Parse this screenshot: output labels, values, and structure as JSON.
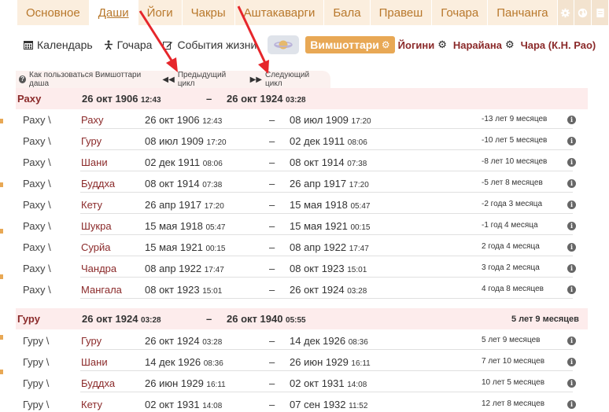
{
  "tabs": [
    {
      "label": "Основное"
    },
    {
      "label": "Даши",
      "active": true
    },
    {
      "label": "Йоги"
    },
    {
      "label": "Чакры"
    },
    {
      "label": "Аштакаварги"
    },
    {
      "label": "Бала"
    },
    {
      "label": "Правеш"
    },
    {
      "label": "Гочара"
    },
    {
      "label": "Панчанга"
    }
  ],
  "subnav": {
    "calendar": "Календарь",
    "gochara": "Гочара",
    "life_events": "События жизни",
    "vimshottari": "Вимшоттари",
    "yogini": "Йогини",
    "narayana": "Нарайана",
    "chara": "Чара (К.Н. Рао)"
  },
  "cycles": {
    "how_to": "Как пользоваться Вимшоттари даша",
    "prev": "Предыдущий цикл",
    "next": "Следующий цикл"
  },
  "dasha": [
    {
      "planet": "Раху",
      "start_date": "26 окт 1906",
      "start_time": "12:43",
      "end_date": "26 окт 1924",
      "end_time": "03:28",
      "duration": "",
      "rows": [
        {
          "lead": "Раху \\",
          "planet": "Раху",
          "sd": "26 окт 1906",
          "st": "12:43",
          "ed": "08 июл 1909",
          "et": "17:20",
          "dur": "-13 лет 9 месяцев"
        },
        {
          "lead": "Раху \\",
          "planet": "Гуру",
          "sd": "08 июл 1909",
          "st": "17:20",
          "ed": "02 дек 1911",
          "et": "08:06",
          "dur": "-10 лет 5 месяцев"
        },
        {
          "lead": "Раху \\",
          "planet": "Шани",
          "sd": "02 дек 1911",
          "st": "08:06",
          "ed": "08 окт 1914",
          "et": "07:38",
          "dur": "-8 лет 10 месяцев"
        },
        {
          "lead": "Раху \\",
          "planet": "Буддха",
          "sd": "08 окт 1914",
          "st": "07:38",
          "ed": "26 апр 1917",
          "et": "17:20",
          "dur": "-5 лет 8 месяцев"
        },
        {
          "lead": "Раху \\",
          "planet": "Кету",
          "sd": "26 апр 1917",
          "st": "17:20",
          "ed": "15 мая 1918",
          "et": "05:47",
          "dur": "-2 года 3 месяца"
        },
        {
          "lead": "Раху \\",
          "planet": "Шукра",
          "sd": "15 мая 1918",
          "st": "05:47",
          "ed": "15 мая 1921",
          "et": "00:15",
          "dur": "-1 год 4 месяца"
        },
        {
          "lead": "Раху \\",
          "planet": "Сурйа",
          "sd": "15 мая 1921",
          "st": "00:15",
          "ed": "08 апр 1922",
          "et": "17:47",
          "dur": "2 года 4 месяца"
        },
        {
          "lead": "Раху \\",
          "planet": "Чандра",
          "sd": "08 апр 1922",
          "st": "17:47",
          "ed": "08 окт 1923",
          "et": "15:01",
          "dur": "3 года 2 месяца"
        },
        {
          "lead": "Раху \\",
          "planet": "Мангала",
          "sd": "08 окт 1923",
          "st": "15:01",
          "ed": "26 окт 1924",
          "et": "03:28",
          "dur": "4 года 8 месяцев"
        }
      ]
    },
    {
      "planet": "Гуру",
      "start_date": "26 окт 1924",
      "start_time": "03:28",
      "end_date": "26 окт 1940",
      "end_time": "05:55",
      "duration": "5 лет 9 месяцев",
      "rows": [
        {
          "lead": "Гуру \\",
          "planet": "Гуру",
          "sd": "26 окт 1924",
          "st": "03:28",
          "ed": "14 дек 1926",
          "et": "08:36",
          "dur": "5 лет 9 месяцев"
        },
        {
          "lead": "Гуру \\",
          "planet": "Шани",
          "sd": "14 дек 1926",
          "st": "08:36",
          "ed": "26 июн 1929",
          "et": "16:11",
          "dur": "7 лет 10 месяцев"
        },
        {
          "lead": "Гуру \\",
          "planet": "Буддха",
          "sd": "26 июн 1929",
          "st": "16:11",
          "ed": "02 окт 1931",
          "et": "14:08",
          "dur": "10 лет 5 месяцев"
        },
        {
          "lead": "Гуру \\",
          "planet": "Кету",
          "sd": "02 окт 1931",
          "st": "14:08",
          "ed": "07 сен 1932",
          "et": "11:52",
          "dur": "12 лет 8 месяцев"
        }
      ]
    }
  ],
  "colors": {
    "accent": "#e8a855",
    "link": "#8b2a2a",
    "tab_text": "#b8782c",
    "arrow": "#e6262b"
  }
}
